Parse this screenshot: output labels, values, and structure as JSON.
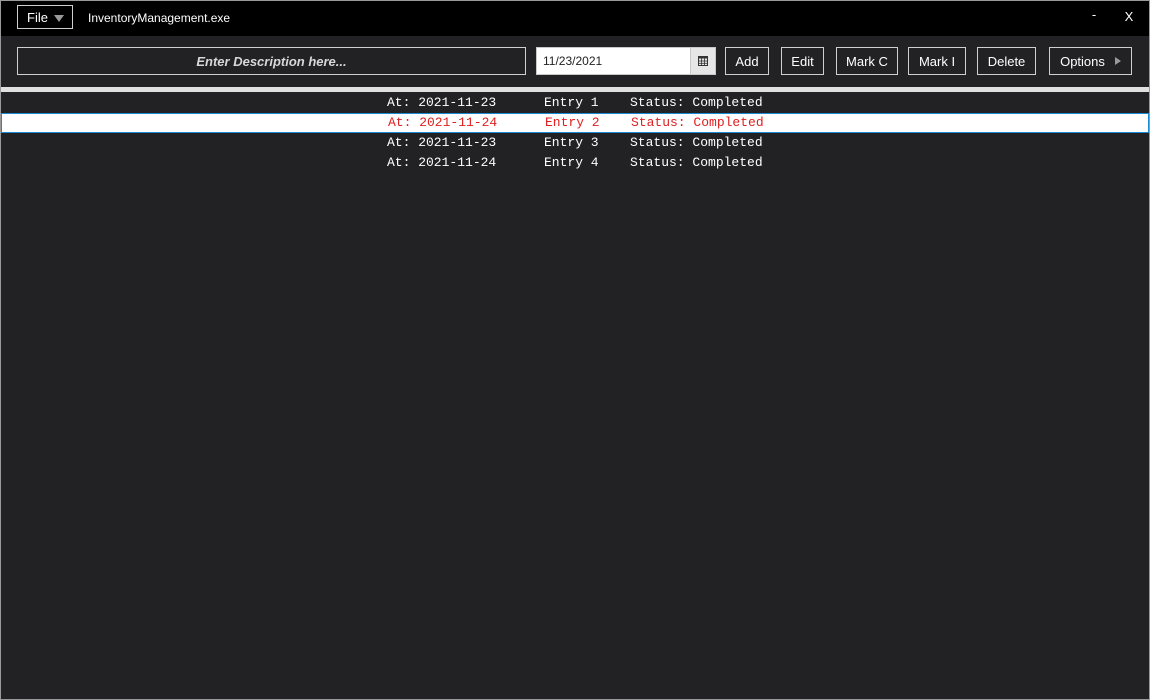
{
  "titlebar": {
    "file_menu_label": "File",
    "app_title": "InventoryManagement.exe",
    "minimize_glyph": "-",
    "close_glyph": "X"
  },
  "toolbar": {
    "description_placeholder": "Enter Description here...",
    "date_value": "11/23/2021",
    "calendar_icon": "calendar-icon",
    "buttons": {
      "add": "Add",
      "edit": "Edit",
      "mark_c": "Mark C",
      "mark_i": "Mark I",
      "delete": "Delete",
      "options": "Options"
    }
  },
  "colors": {
    "background": "#222224",
    "titlebar": "#000000",
    "selected_row_background": "#ffffff",
    "selected_row_text": "#e02020",
    "selected_row_border": "#1a8ad4"
  },
  "entries": [
    {
      "date": "At: 2021-11-23",
      "name": "Entry 1",
      "status": "Status: Completed",
      "selected": false
    },
    {
      "date": "At: 2021-11-24",
      "name": "Entry 2",
      "status": "Status: Completed",
      "selected": true
    },
    {
      "date": "At: 2021-11-23",
      "name": "Entry 3",
      "status": "Status: Completed",
      "selected": false
    },
    {
      "date": "At: 2021-11-24",
      "name": "Entry 4",
      "status": "Status: Completed",
      "selected": false
    }
  ]
}
